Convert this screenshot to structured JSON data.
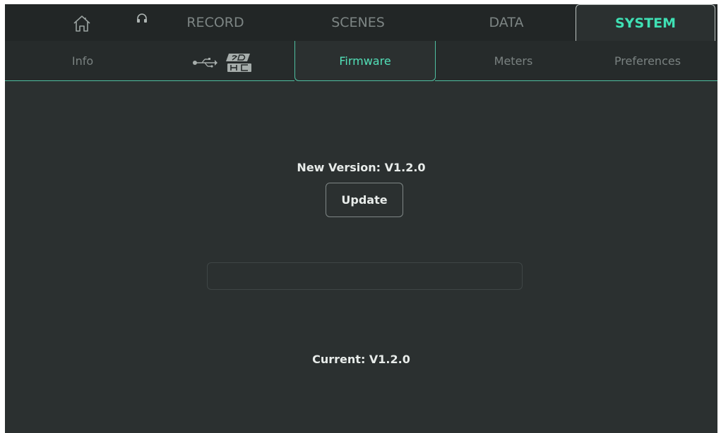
{
  "top_tabs": {
    "record": "RECORD",
    "scenes": "SCENES",
    "data": "DATA",
    "system": "SYSTEM",
    "home_icon": "home-icon",
    "headphones_icon": "headphones-icon"
  },
  "sub_tabs": {
    "info": "Info",
    "usb_icon": "usb-icon",
    "sdhc_icon": "sdhc-icon",
    "firmware": "Firmware",
    "meters": "Meters",
    "preferences": "Preferences"
  },
  "firmware": {
    "new_version": "New Version: V1.2.0",
    "update_label": "Update",
    "progress_fraction": 0,
    "current_version": "Current: V1.2.0"
  },
  "colors": {
    "accent": "#3fe0b4",
    "background": "#2b3030",
    "tab_bar": "#222626"
  }
}
